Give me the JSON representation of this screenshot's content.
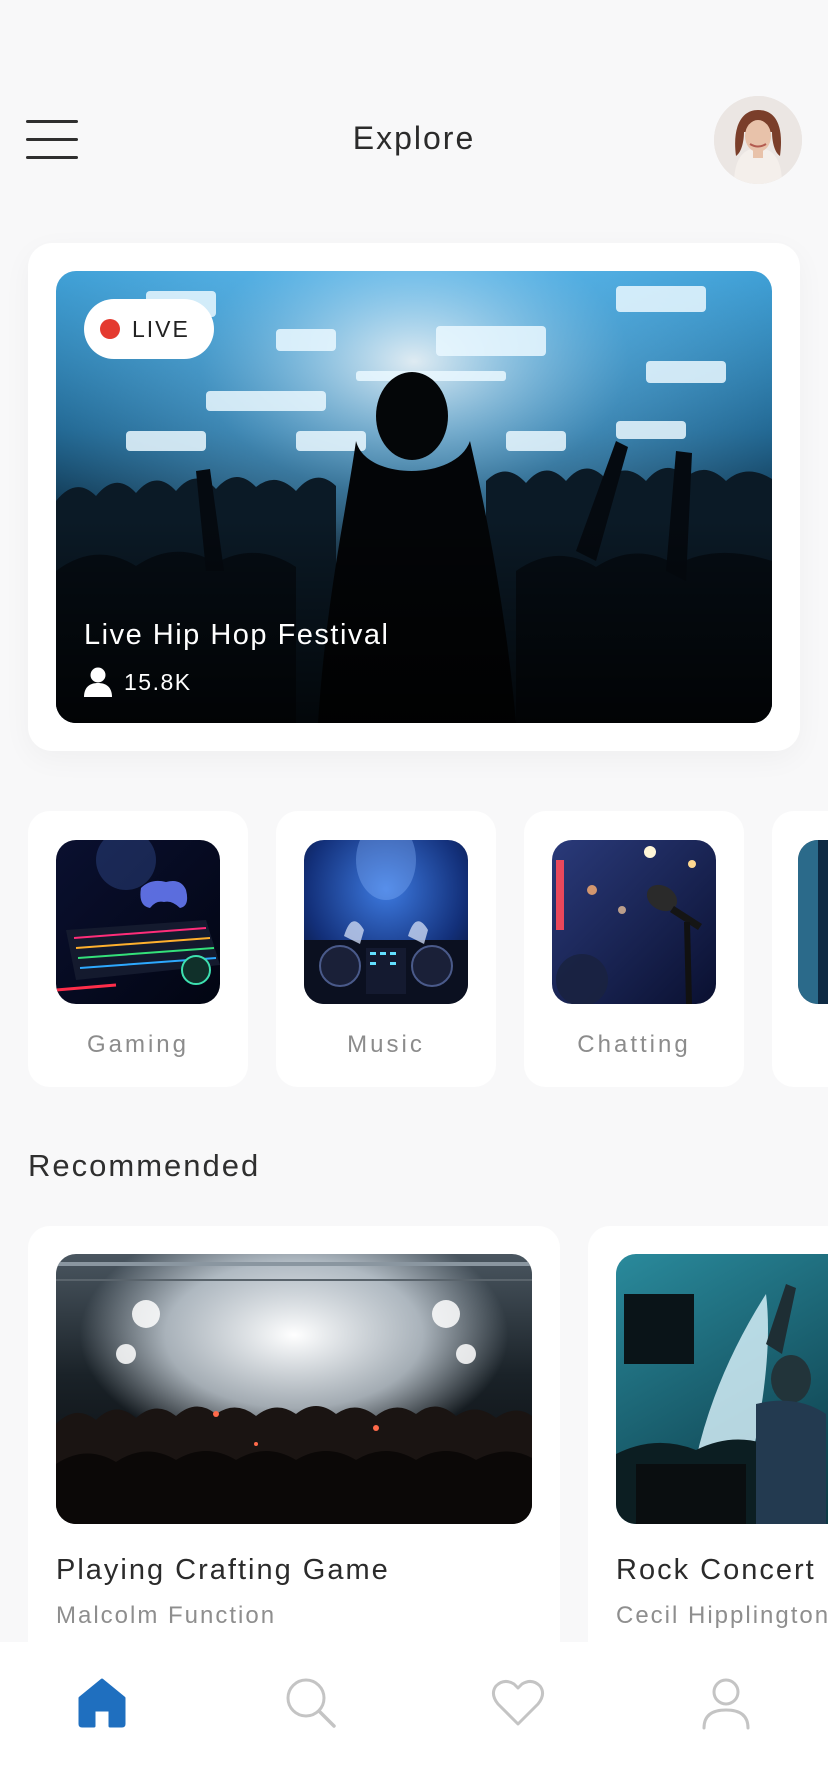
{
  "header": {
    "title": "Explore",
    "menu_icon": "hamburger-icon",
    "avatar_icon": "user-avatar"
  },
  "featured": {
    "badge": "LIVE",
    "title": "Live Hip Hop Festival",
    "viewers": "15.8K",
    "viewers_icon": "person-icon",
    "live_color": "#e43a2f"
  },
  "categories": [
    {
      "label": "Gaming"
    },
    {
      "label": "Music"
    },
    {
      "label": "Chatting"
    }
  ],
  "recommended": {
    "title": "Recommended",
    "items": [
      {
        "title": "Playing Crafting Game",
        "author": "Malcolm Function"
      },
      {
        "title": "Rock Concert",
        "author": "Cecil Hipplington"
      }
    ]
  },
  "nav": {
    "items": [
      "home-icon",
      "search-icon",
      "heart-icon",
      "profile-icon"
    ],
    "active_color": "#1f6fbf",
    "inactive_color": "#c4c4c4"
  }
}
